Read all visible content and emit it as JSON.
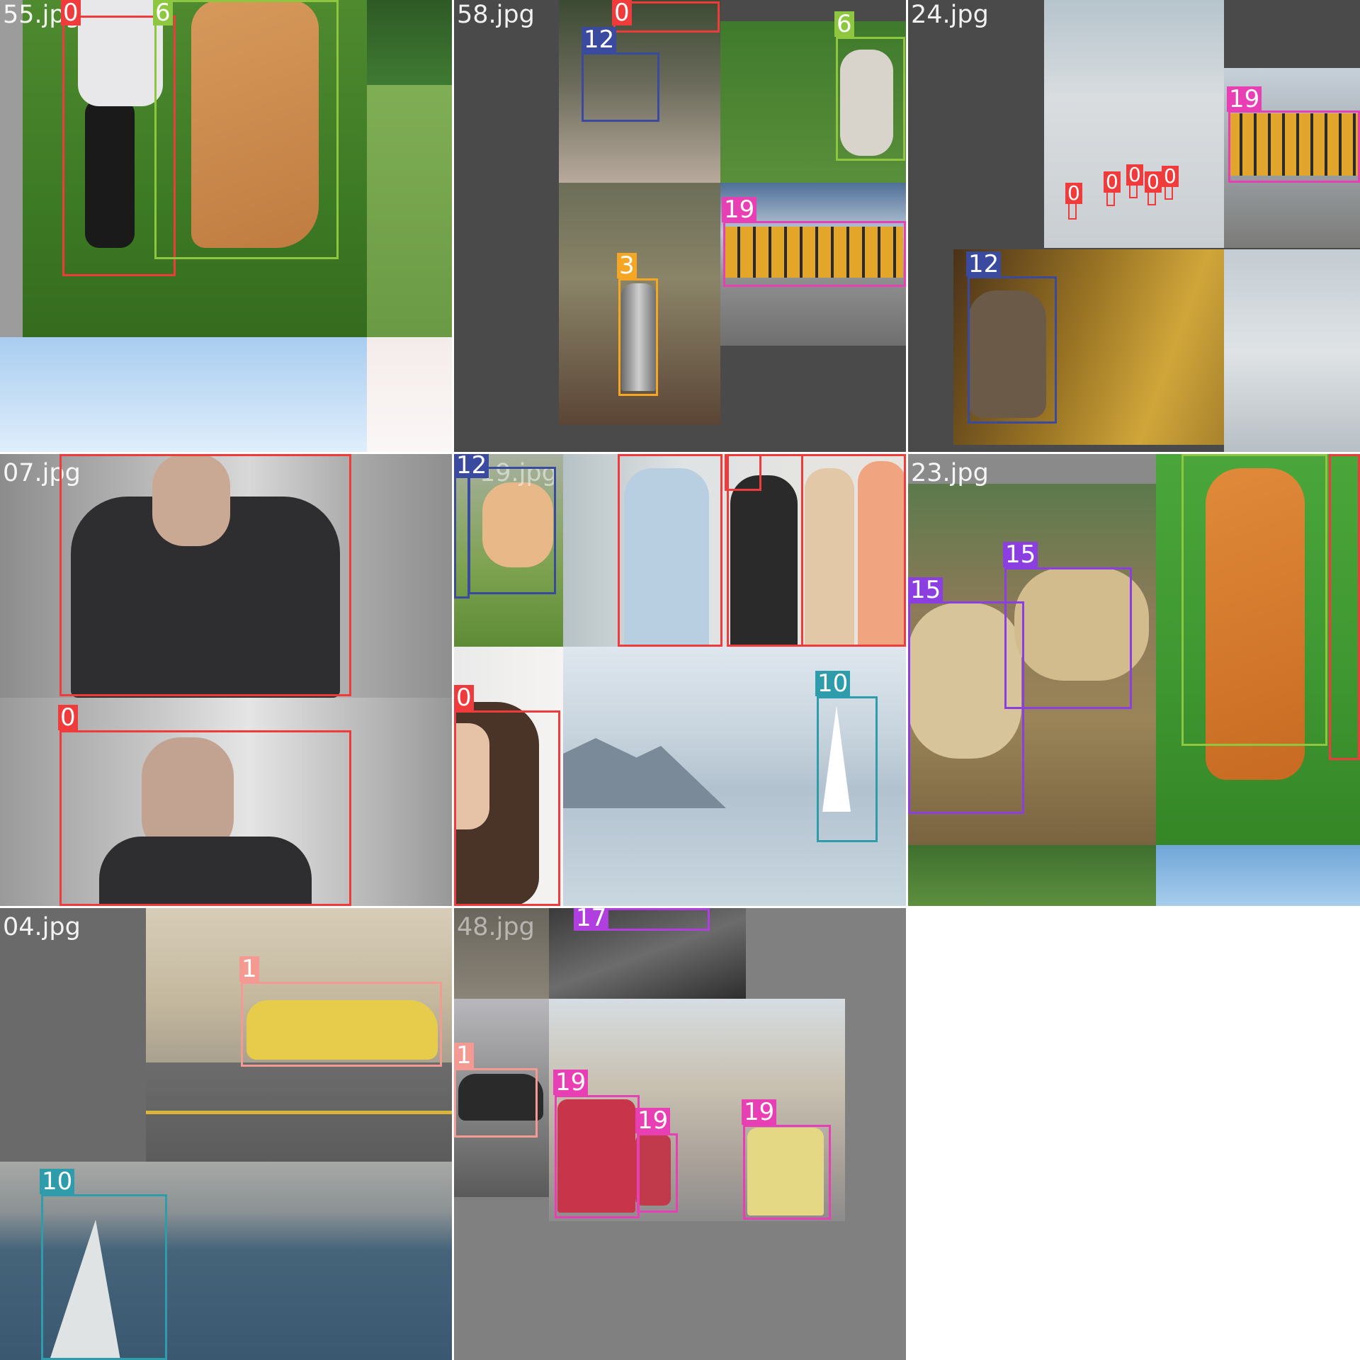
{
  "mosaic": {
    "class_colors": {
      "0": "#ef3b3b",
      "1": "#f59a93",
      "3": "#f5a623",
      "6": "#8dc63f",
      "10": "#2e9caa",
      "12": "#3a4a9e",
      "15": "#8b3fe0",
      "17": "#b13fe0",
      "19": "#e83fb5"
    },
    "tiles": [
      {
        "filename": "55.jpg",
        "boxes": [
          {
            "label": "0",
            "color": "#ef3b3b"
          },
          {
            "label": "6",
            "color": "#8dc63f"
          }
        ]
      },
      {
        "filename": "58.jpg",
        "boxes": [
          {
            "label": "0",
            "color": "#ef3b3b"
          },
          {
            "label": "12",
            "color": "#3a4a9e"
          },
          {
            "label": "6",
            "color": "#8dc63f"
          },
          {
            "label": "3",
            "color": "#f5a623"
          },
          {
            "label": "19",
            "color": "#e83fb5"
          }
        ]
      },
      {
        "filename": "24.jpg",
        "boxes": [
          {
            "label": "19",
            "color": "#e83fb5"
          },
          {
            "label": "12",
            "color": "#3a4a9e"
          },
          {
            "label": "0",
            "color": "#ef3b3b"
          },
          {
            "label": "0",
            "color": "#ef3b3b"
          },
          {
            "label": "0",
            "color": "#ef3b3b"
          },
          {
            "label": "0",
            "color": "#ef3b3b"
          },
          {
            "label": "0",
            "color": "#ef3b3b"
          }
        ]
      },
      {
        "filename": "07.jpg",
        "boxes": [
          {
            "label": "0",
            "color": "#ef3b3b"
          },
          {
            "label": "0",
            "color": "#ef3b3b"
          }
        ]
      },
      {
        "filename": "19.jpg",
        "boxes": [
          {
            "label": "12",
            "color": "#3a4a9e"
          },
          {
            "label": "12",
            "color": "#3a4a9e"
          },
          {
            "label": "0",
            "color": "#ef3b3b"
          },
          {
            "label": "0",
            "color": "#ef3b3b"
          },
          {
            "label": "0",
            "color": "#ef3b3b"
          },
          {
            "label": "0",
            "color": "#ef3b3b"
          },
          {
            "label": "0",
            "color": "#ef3b3b"
          },
          {
            "label": "10",
            "color": "#2e9caa"
          }
        ]
      },
      {
        "filename": "23.jpg",
        "boxes": [
          {
            "label": "6",
            "color": "#8dc63f"
          },
          {
            "label": "0",
            "color": "#ef3b3b"
          },
          {
            "label": "15",
            "color": "#8b3fe0"
          },
          {
            "label": "15",
            "color": "#8b3fe0"
          }
        ]
      },
      {
        "filename": "04.jpg",
        "boxes": [
          {
            "label": "1",
            "color": "#f59a93"
          },
          {
            "label": "10",
            "color": "#2e9caa"
          }
        ]
      },
      {
        "filename": "48.jpg",
        "boxes": [
          {
            "label": "17",
            "color": "#b13fe0"
          },
          {
            "label": "1",
            "color": "#f59a93"
          },
          {
            "label": "19",
            "color": "#e83fb5"
          },
          {
            "label": "19",
            "color": "#e83fb5"
          },
          {
            "label": "19",
            "color": "#e83fb5"
          }
        ]
      }
    ]
  }
}
